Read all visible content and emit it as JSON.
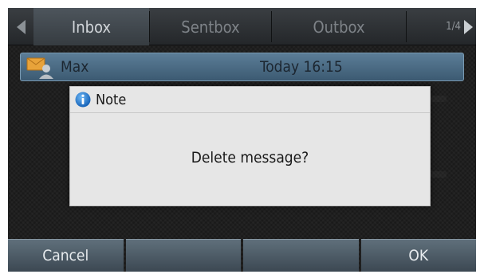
{
  "tabs": [
    {
      "label": "Inbox",
      "active": true
    },
    {
      "label": "Sentbox",
      "active": false
    },
    {
      "label": "Outbox",
      "active": false
    }
  ],
  "pager": {
    "text": "1/4"
  },
  "message": {
    "sender": "Max",
    "time": "Today 16:15",
    "icon": "envelope-person-icon"
  },
  "dialog": {
    "title": "Note",
    "text": "Delete message?",
    "icon": "info-icon"
  },
  "softkeys": [
    {
      "label": "Cancel"
    },
    {
      "label": ""
    },
    {
      "label": ""
    },
    {
      "label": "OK"
    }
  ],
  "colors": {
    "active_tab": "#4d555c",
    "message_row": "#4a6a84",
    "dialog_bg": "#e6e6e6",
    "softkey": "#4e5c67",
    "info_blue": "#1f7fd6"
  }
}
